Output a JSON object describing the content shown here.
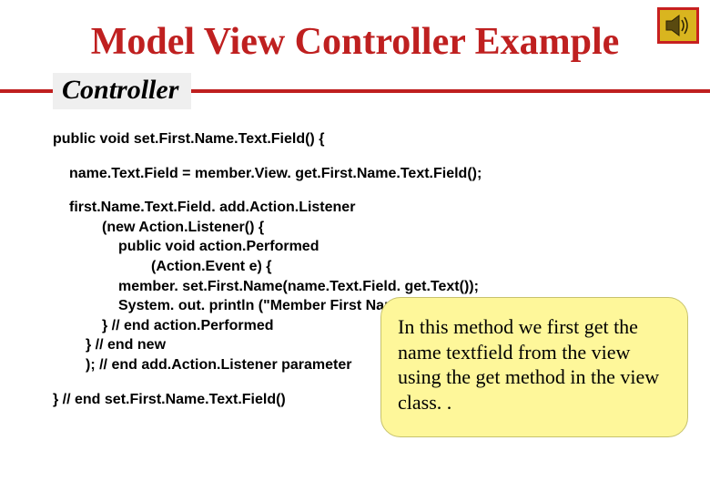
{
  "title": "Model View Controller Example",
  "subtitle": "Controller",
  "code": {
    "l1": "public void set.First.Name.Text.Field() {",
    "l2": "name.Text.Field = member.View. get.First.Name.Text.Field();",
    "l3": "first.Name.Text.Field. add.Action.Listener",
    "l4": "(new Action.Listener() {",
    "l5": "public void action.Performed",
    "l6": "(Action.Event e) {",
    "l7": "member. set.First.Name(name.Text.Field. get.Text());",
    "l8": "System. out. println (\"Member First Name set\");",
    "l9": "} // end action.Performed",
    "l10": "} // end new",
    "l11": "); // end add.Action.Listener parameter",
    "l12": "} // end set.First.Name.Text.Field()"
  },
  "callout": "In this method we first get the name textfield from the view using the get method in the view class.  .",
  "icon_name": "speaker-icon"
}
